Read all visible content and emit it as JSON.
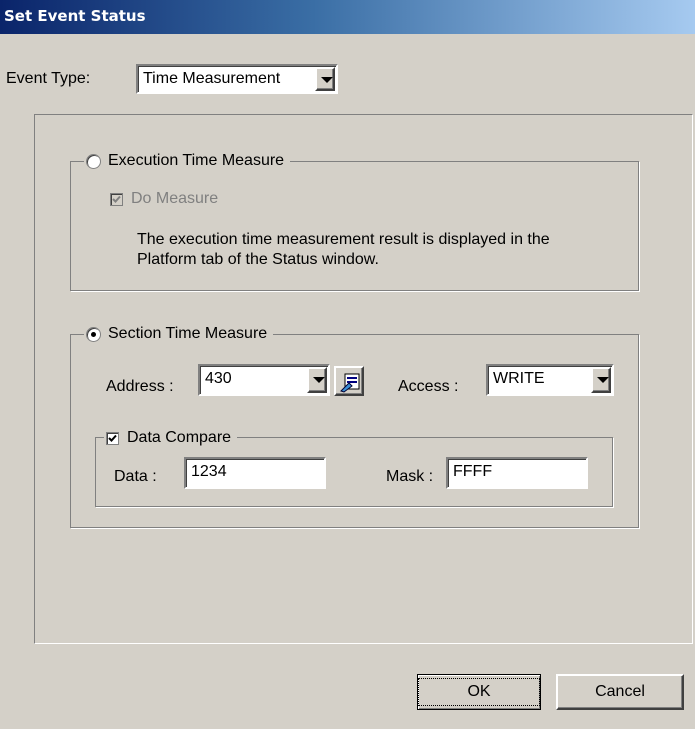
{
  "window": {
    "title": "Set Event Status"
  },
  "event_type": {
    "label": "Event Type:",
    "value": "Time Measurement"
  },
  "execution": {
    "legend": "Execution Time Measure",
    "selected": false,
    "do_measure_label": "Do Measure",
    "do_measure_checked": true,
    "description_line1": "The execution time measurement result is displayed in the",
    "description_line2": "Platform tab of the Status window."
  },
  "section": {
    "legend": "Section Time Measure",
    "selected": true,
    "address_label": "Address :",
    "address_value": "430",
    "access_label": "Access :",
    "access_value": "WRITE"
  },
  "data_compare": {
    "legend": "Data Compare",
    "checked": true,
    "data_label": "Data :",
    "data_value": "1234",
    "mask_label": "Mask :",
    "mask_value": "FFFF"
  },
  "buttons": {
    "ok": "OK",
    "cancel": "Cancel"
  },
  "icons": {
    "symbol_browse": "symbol-browse-icon",
    "dropdown": "chevron-down-icon"
  }
}
